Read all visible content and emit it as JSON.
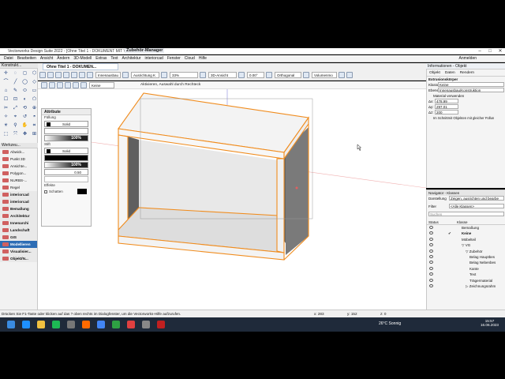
{
  "titlebar": {
    "title": "Vectorworks Design Suite 2022 - [Ohne Titel 1 - DOKUMENT MIT V",
    "manager": "Zubehör-Manager",
    "min": "–",
    "max": "□",
    "close": "✕"
  },
  "menu": [
    "Datei",
    "Bearbeiten",
    "Ansicht",
    "Ändern",
    "3D-Modell",
    "Extras",
    "Text",
    "Architektur",
    "interiorcad",
    "Fenster",
    "Cloud",
    "Hilfe"
  ],
  "login": "Anmelden",
  "document_tab": "Ohne Titel 1 - DOKUMEN...",
  "info_header": "Informationen - Objekt",
  "left_palette_title": "Konstrukt...",
  "tool_icons": [
    "✛",
    "◌",
    "◻",
    "⬡",
    "⌒",
    "╱",
    "◯",
    "◇",
    "⌂",
    "✎",
    "⬭",
    "▭",
    "☐",
    "⊡",
    "◐",
    "⬠",
    "✂",
    "⤢",
    "⟲",
    "⊕",
    "✧",
    "⌖",
    "↺",
    "◓",
    "☀",
    "⚲",
    "✋",
    "⌗",
    "⬚",
    "⤧",
    "✥",
    "⊞"
  ],
  "viewbar": {
    "sel1": "Innenausbau",
    "sel2": "Ausrichtung K",
    "zoom": "33%",
    "view": "3D-Ansicht",
    "angle": "0.00°",
    "proj": "Orthogonal",
    "render": "Volumenmo"
  },
  "modebar": {
    "hint": "Aktivieren, Auswahl durch Rechteck",
    "keine": "Keine"
  },
  "workspace": {
    "title": "Werkzeu...",
    "items": [
      {
        "label": "Abwick...",
        "style": ""
      },
      {
        "label": "Punkt 3D",
        "style": ""
      },
      {
        "label": "Ansichte...",
        "style": ""
      },
      {
        "label": "Polygon...",
        "style": ""
      },
      {
        "label": "NURBS-...",
        "style": ""
      },
      {
        "label": "Regel",
        "style": ""
      },
      {
        "label": "interiorcad",
        "style": "bold"
      },
      {
        "label": "interiorcad",
        "style": "bold"
      },
      {
        "label": "Bemaßung",
        "style": "bold"
      },
      {
        "label": "Architektur",
        "style": "bold"
      },
      {
        "label": "Innenarchi",
        "style": "bold"
      },
      {
        "label": "Landschaft",
        "style": "bold"
      },
      {
        "label": "GIS",
        "style": "bold"
      },
      {
        "label": "Modellieren",
        "style": "active"
      },
      {
        "label": "Visualisier...",
        "style": "bold"
      },
      {
        "label": "Objekt/N...",
        "style": "bold"
      }
    ]
  },
  "attributes": {
    "title": "Attribute",
    "fill_label": "Füllung",
    "fill_value": "Solid",
    "fill_opacity": "100%",
    "pen_label": "Stift",
    "pen_value": "Solid",
    "pen_opacity": "100%",
    "line_width": "0.50",
    "effects_label": "Effekte",
    "shadow_label": "Schatten"
  },
  "info": {
    "tabs": [
      "Objekt",
      "Daten",
      "Rendern"
    ],
    "object_type": "Extrusionskörper",
    "class_label": "Klasse:",
    "class_value": "Keine",
    "layer_label": "Ebene:",
    "layer_value": "Innenausbau/Konstruktion",
    "material_label": "Material verwenden",
    "dx_label": "Δx:",
    "dx_value": "478.99",
    "dy_label": "Δy:",
    "dy_value": "297.01",
    "dz_label": "Δz:",
    "dz_value": "200",
    "checkbox_text": "Im Schnittmit Objekten mit gleicher Füllun",
    "name_label": "Name:"
  },
  "navigator": {
    "title": "Navigator - Klassen",
    "display_label": "Darstellung",
    "display_value": "Zeigen, ausrichten und bearbe",
    "filter_label": "Filter",
    "filter_value": "<Alle Klassen>",
    "search_placeholder": "Suchen",
    "col_status": "Status",
    "col_class": "Klasse",
    "rows": [
      {
        "label": "Bemaßung",
        "indent": 0,
        "check": ""
      },
      {
        "label": "Keine",
        "indent": 0,
        "check": "✔",
        "bold": true
      },
      {
        "label": "Möbelteil",
        "indent": 0,
        "check": ""
      },
      {
        "label": "▽ VG",
        "indent": 0,
        "check": ""
      },
      {
        "label": "▽ Zubehör",
        "indent": 1,
        "check": ""
      },
      {
        "label": "Belag Hauptbes",
        "indent": 2,
        "check": ""
      },
      {
        "label": "Belag Nebenbes",
        "indent": 2,
        "check": ""
      },
      {
        "label": "Kante",
        "indent": 2,
        "check": ""
      },
      {
        "label": "Text",
        "indent": 2,
        "check": ""
      },
      {
        "label": "Trägermaterial",
        "indent": 2,
        "check": ""
      },
      {
        "label": "▷ Zeichnungsrahm",
        "indent": 1,
        "check": ""
      }
    ]
  },
  "status": {
    "hint": "Drücken Sie F1-Taste oder klicken auf das ? oben rechts im Dialogfenster, um die Vectorworks-Hilfe aufzurufen.",
    "x": "x: 283",
    "y": "y: 152",
    "z": "z: 0"
  },
  "taskbar": {
    "weather": "26°C Sonnig",
    "time": "15:57",
    "date": "16.06.2023",
    "icon_colors": [
      "#1e90ff",
      "#f0c040",
      "#1db954",
      "#777777",
      "#ff6a00",
      "#4285f4",
      "#2ea043",
      "#e04040",
      "#888888",
      "#c02020"
    ]
  }
}
